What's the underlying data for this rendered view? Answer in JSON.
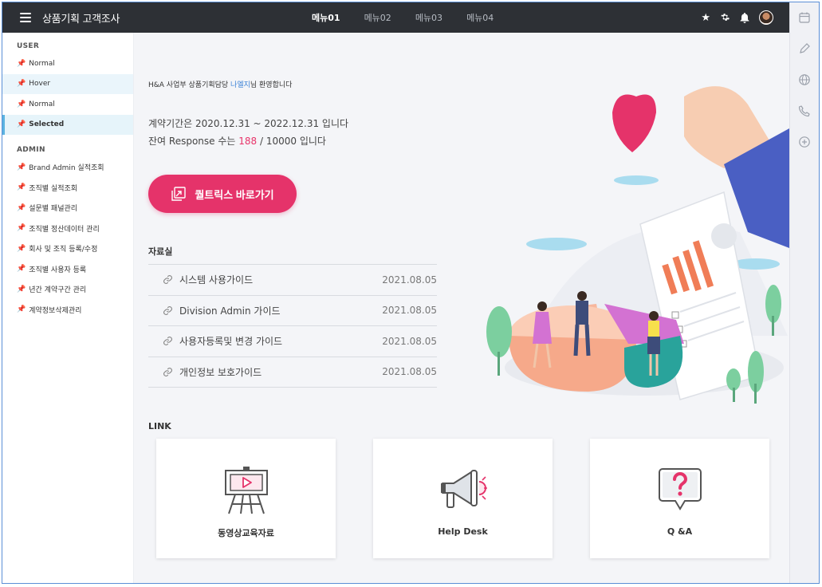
{
  "app": {
    "title": "상품기획 고객조사"
  },
  "menu": [
    {
      "label": "메뉴01",
      "active": true
    },
    {
      "label": "메뉴02",
      "active": false
    },
    {
      "label": "메뉴03",
      "active": false
    },
    {
      "label": "메뉴04",
      "active": false
    }
  ],
  "top_icons": [
    "star-icon",
    "gear-icon",
    "bell-icon",
    "avatar"
  ],
  "rail_icons": [
    "calendar-icon",
    "pencil-icon",
    "globe-icon",
    "phone-icon",
    "plus-circle-icon"
  ],
  "sidebar": {
    "user_title": "USER",
    "user_items": [
      {
        "label": "Normal",
        "state": "normal"
      },
      {
        "label": "Hover",
        "state": "hover"
      },
      {
        "label": "Normal",
        "state": "normal"
      },
      {
        "label": "Selected",
        "state": "selected"
      }
    ],
    "admin_title": "ADMIN",
    "admin_items": [
      "Brand Admin 실적조회",
      "조직별 실적조회",
      "설문별 패널관리",
      "조직별 정산데이터 관리",
      "회사 및 조직 등록/수정",
      "조직별 사용자 등록",
      "년간 계약구간 관리",
      "계약정보삭제관리"
    ]
  },
  "welcome": {
    "prefix": "H&A 사업부 상품기획담당 ",
    "name": "나엘지",
    "suffix": "님 환영합니다"
  },
  "contract": {
    "line1": "계약기간은 2020.12.31 ~ 2022.12.31 입니다",
    "line2_prefix": "잔여 Response 수는 ",
    "remaining": "188",
    "line2_suffix": " / 10000  입니다"
  },
  "qualtrics_button": "퀄트릭스 바로가기",
  "library": {
    "title": "자료실",
    "items": [
      {
        "label": "시스템 사용가이드",
        "date": "2021.08.05"
      },
      {
        "label": "Division Admin 가이드",
        "date": "2021.08.05"
      },
      {
        "label": "사용자등록및 변경 가이드",
        "date": "2021.08.05"
      },
      {
        "label": "개인정보 보호가이드",
        "date": "2021.08.05"
      }
    ]
  },
  "links": {
    "title": "LINK",
    "cards": [
      {
        "label": "동영상교육자료",
        "icon": "video-easel-icon"
      },
      {
        "label": "Help Desk",
        "icon": "megaphone-icon"
      },
      {
        "label": "Q &A",
        "icon": "question-bubble-icon"
      }
    ]
  },
  "colors": {
    "accent": "#e5336a",
    "topbar": "#2d3035",
    "link_name": "#3b82d6",
    "selected_bar": "#5bb3e0"
  }
}
